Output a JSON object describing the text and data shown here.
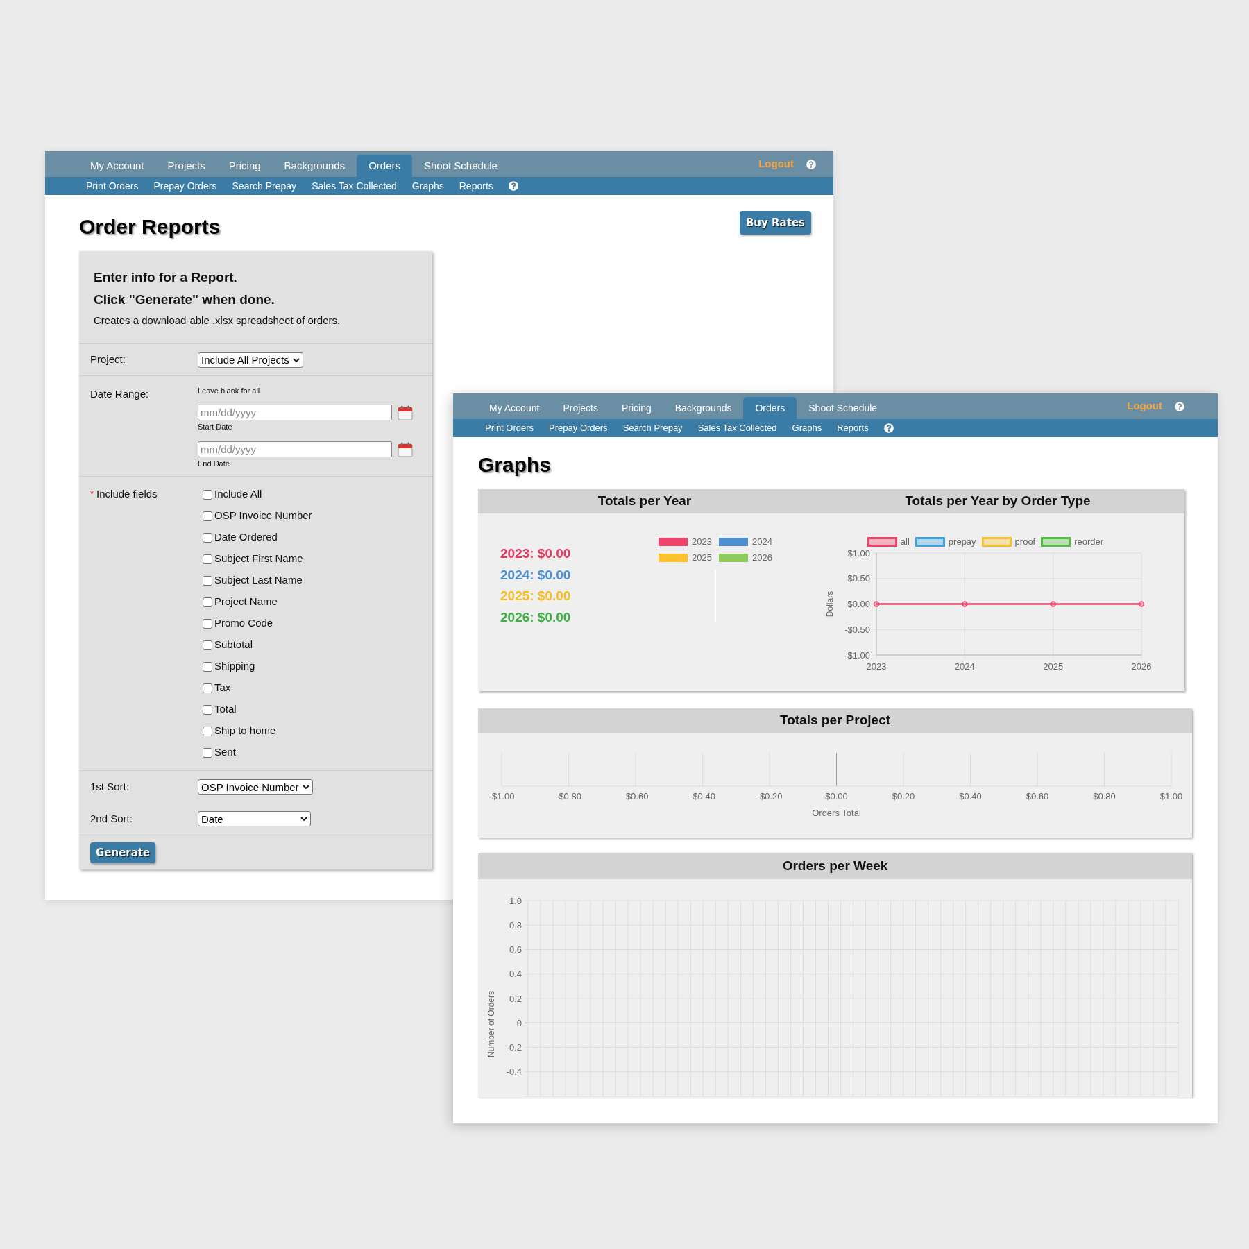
{
  "order_reports_window": {
    "nav": {
      "tabs": [
        {
          "label": "My Account",
          "selected": false
        },
        {
          "label": "Projects",
          "selected": false
        },
        {
          "label": "Pricing",
          "selected": false
        },
        {
          "label": "Backgrounds",
          "selected": false
        },
        {
          "label": "Orders",
          "selected": true
        },
        {
          "label": "Shoot Schedule",
          "selected": false
        }
      ],
      "logout": "Logout"
    },
    "subnav": [
      "Print Orders",
      "Prepay Orders",
      "Search Prepay",
      "Sales Tax Collected",
      "Graphs",
      "Reports"
    ],
    "title": "Order Reports",
    "buy_rates_button": "Buy Rates",
    "form": {
      "heading": [
        "Enter info for a Report.",
        "Click \"Generate\" when done."
      ],
      "description": "Creates a download-able .xlsx spreadsheet of orders.",
      "project": {
        "label": "Project:",
        "value": "Include All Projects"
      },
      "date_range": {
        "label": "Date Range:",
        "hint": "Leave blank for all",
        "fields": [
          {
            "placeholder": "mm/dd/yyyy",
            "caption": "Start Date"
          },
          {
            "placeholder": "mm/dd/yyyy",
            "caption": "End Date"
          }
        ]
      },
      "include_fields": {
        "required_mark": "*",
        "label": "Include fields",
        "options": [
          {
            "label": "Include All",
            "checked": false
          },
          {
            "label": "OSP Invoice Number",
            "checked": false
          },
          {
            "label": "Date Ordered",
            "checked": false
          },
          {
            "label": "Subject First Name",
            "checked": false
          },
          {
            "label": "Subject Last Name",
            "checked": false
          },
          {
            "label": "Project Name",
            "checked": false
          },
          {
            "label": "Promo Code",
            "checked": false
          },
          {
            "label": "Subtotal",
            "checked": false
          },
          {
            "label": "Shipping",
            "checked": false
          },
          {
            "label": "Tax",
            "checked": false
          },
          {
            "label": "Total",
            "checked": false
          },
          {
            "label": "Ship to home",
            "checked": false
          },
          {
            "label": "Sent",
            "checked": false
          }
        ]
      },
      "sorts": [
        {
          "label": "1st Sort:",
          "value": "OSP Invoice Number"
        },
        {
          "label": "2nd Sort:",
          "value": "Date"
        }
      ],
      "generate_button": "Generate"
    }
  },
  "graphs_window": {
    "nav": {
      "tabs": [
        {
          "label": "My Account",
          "selected": false
        },
        {
          "label": "Projects",
          "selected": false
        },
        {
          "label": "Pricing",
          "selected": false
        },
        {
          "label": "Backgrounds",
          "selected": false
        },
        {
          "label": "Orders",
          "selected": true
        },
        {
          "label": "Shoot Schedule",
          "selected": false
        }
      ],
      "logout": "Logout"
    },
    "subnav": [
      "Print Orders",
      "Prepay Orders",
      "Search Prepay",
      "Sales Tax Collected",
      "Graphs",
      "Reports"
    ],
    "title": "Graphs",
    "year_panel": {
      "title": "Totals per Year",
      "totals": [
        {
          "text": "2023: $0.00",
          "color": "#e8385f"
        },
        {
          "text": "2024: $0.00",
          "color": "#4a8fd3"
        },
        {
          "text": "2025: $0.00",
          "color": "#f8bb22"
        },
        {
          "text": "2026: $0.00",
          "color": "#3cb043"
        }
      ],
      "legend": [
        {
          "label": "2023",
          "color": "#f0436b"
        },
        {
          "label": "2024",
          "color": "#4f8fd0"
        },
        {
          "label": "2025",
          "color": "#fcc22f"
        },
        {
          "label": "2026",
          "color": "#8fca5d"
        }
      ]
    },
    "order_type_panel": {
      "title": "Totals per Year by Order Type",
      "chart_data": {
        "type": "line",
        "ylabel": "Dollars",
        "categories": [
          "2023",
          "2024",
          "2025",
          "2026"
        ],
        "grid": true,
        "legend": "top",
        "series": [
          {
            "name": "all",
            "color": "#ee4369",
            "marker": "circle",
            "values": [
              0,
              0,
              0,
              0
            ]
          },
          {
            "name": "prepay",
            "color": "#42a1dc",
            "values": [
              null,
              null,
              null,
              null
            ]
          },
          {
            "name": "proof",
            "color": "#f6c12f",
            "values": [
              null,
              null,
              null,
              null
            ]
          },
          {
            "name": "reorder",
            "color": "#58bd44",
            "values": [
              null,
              null,
              null,
              null
            ]
          }
        ],
        "ylim": [
          -1,
          1
        ],
        "yticks": [
          {
            "value": 1,
            "label": "$1.00"
          },
          {
            "value": 0.5,
            "label": "$0.50"
          },
          {
            "value": 0,
            "label": "$0.00"
          },
          {
            "value": -0.5,
            "label": "-$0.50"
          },
          {
            "value": -1,
            "label": "-$1.00"
          }
        ]
      }
    },
    "project_panel": {
      "title": "Totals per Project",
      "x_axis": {
        "tick_labels": [
          "-$1.00",
          "-$0.80",
          "-$0.60",
          "-$0.40",
          "-$0.20",
          "$0.00",
          "$0.20",
          "$0.40",
          "$0.60",
          "$0.80",
          "$1.00"
        ],
        "title": "Orders Total"
      }
    },
    "week_panel": {
      "title": "Orders per Week",
      "y_axis": {
        "tick_labels": [
          "1.0",
          "0.8",
          "0.6",
          "0.4",
          "0.2",
          "0",
          "-0.2",
          "-0.4"
        ],
        "title": "Number of Orders"
      }
    }
  }
}
